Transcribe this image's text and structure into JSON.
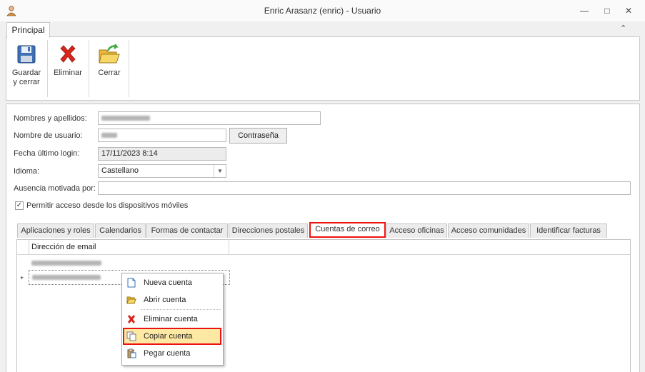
{
  "window": {
    "title": "Enric Arasanz (enric) - Usuario",
    "minimize": "—",
    "maximize": "□",
    "close": "✕"
  },
  "ribbon": {
    "tab": "Principal",
    "collapse": "⌃",
    "buttons": {
      "save_l1": "Guardar",
      "save_l2": "y cerrar",
      "delete": "Eliminar",
      "close": "Cerrar"
    }
  },
  "form": {
    "name_label": "Nombres y apellidos:",
    "username_label": "Nombre de usuario:",
    "password_button": "Contraseña",
    "lastlogin_label": "Fecha último login:",
    "lastlogin_value": "17/11/2023 8:14",
    "language_label": "Idioma:",
    "language_value": "Castellano",
    "absence_label": "Ausencia motivada por:",
    "mobile_checkbox": "Permitir acceso desde los dispositivos móviles"
  },
  "tabs": [
    "Aplicaciones y roles",
    "Calendarios",
    "Formas de contactar",
    "Direcciones postales",
    "Cuentas de correo",
    "Acceso oficinas",
    "Acceso comunidades",
    "Identificar facturas"
  ],
  "grid": {
    "column": "Dirección de email"
  },
  "context_menu": {
    "new": "Nueva cuenta",
    "open": "Abrir cuenta",
    "delete": "Eliminar cuenta",
    "copy": "Copiar cuenta",
    "paste": "Pegar cuenta"
  },
  "colors": {
    "highlight_border": "#e11",
    "hover_bg": "#fde9a4",
    "delete_red": "#d9261c"
  }
}
